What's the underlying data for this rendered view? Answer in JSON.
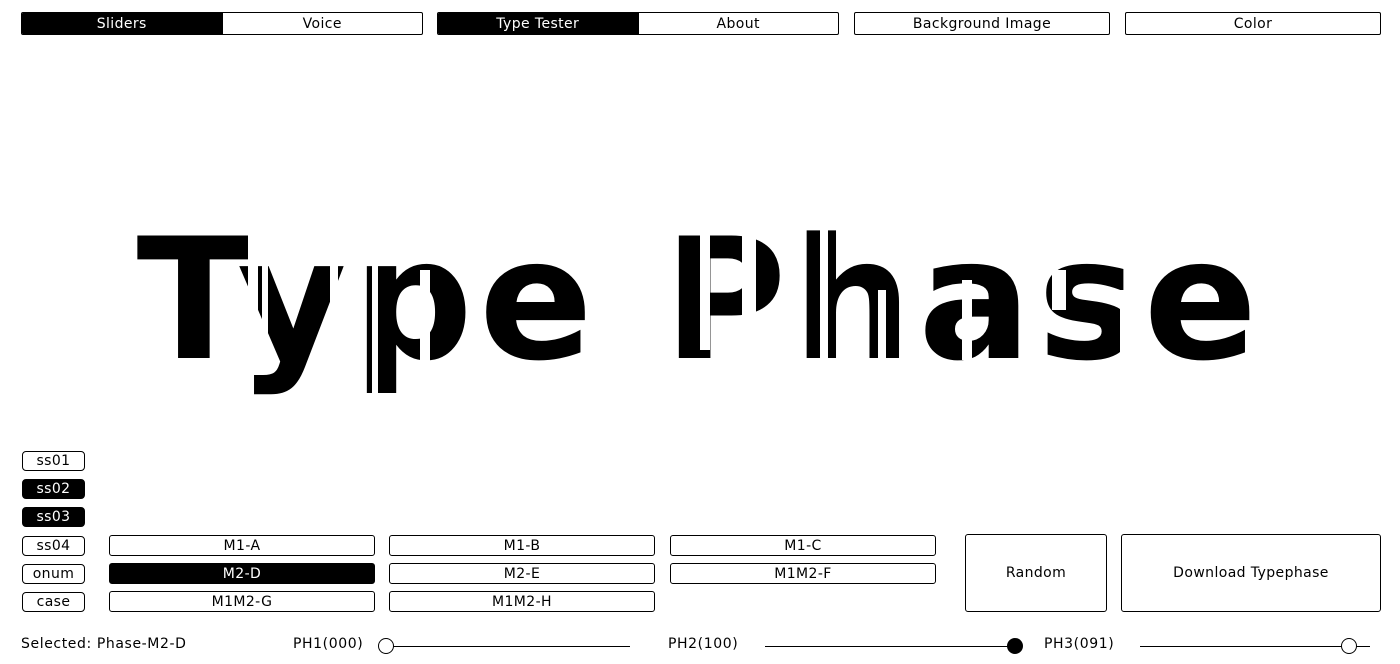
{
  "nav": {
    "mode_tabs": [
      {
        "label": "Sliders",
        "active": true
      },
      {
        "label": "Voice",
        "active": false
      }
    ],
    "view_tabs": [
      {
        "label": "Type Tester",
        "active": true
      },
      {
        "label": "About",
        "active": false
      }
    ],
    "background_image_label": "Background Image",
    "color_label": "Color"
  },
  "preview": {
    "text": "Type Phase"
  },
  "features": [
    {
      "label": "ss01",
      "active": false
    },
    {
      "label": "ss02",
      "active": true
    },
    {
      "label": "ss03",
      "active": true
    },
    {
      "label": "ss04",
      "active": false
    },
    {
      "label": "onum",
      "active": false
    },
    {
      "label": "case",
      "active": false
    }
  ],
  "variants": [
    {
      "label": "M1-A",
      "active": false
    },
    {
      "label": "M1-B",
      "active": false
    },
    {
      "label": "M1-C",
      "active": false
    },
    {
      "label": "M2-D",
      "active": true
    },
    {
      "label": "M2-E",
      "active": false
    },
    {
      "label": "M1M2-F",
      "active": false
    },
    {
      "label": "M1M2-G",
      "active": false
    },
    {
      "label": "M1M2-H",
      "active": false
    }
  ],
  "actions": {
    "random_label": "Random",
    "download_label": "Download Typephase"
  },
  "footer": {
    "selected_label": "Selected: Phase-M2-D",
    "ph1_label": "PH1(000)",
    "ph2_label": "PH2(100)",
    "ph3_label": "PH3(091)",
    "ph1_value": 0,
    "ph2_value": 1.0,
    "ph3_value": 0.91
  },
  "colors": {
    "background": "#ffffff",
    "foreground": "#000000"
  }
}
